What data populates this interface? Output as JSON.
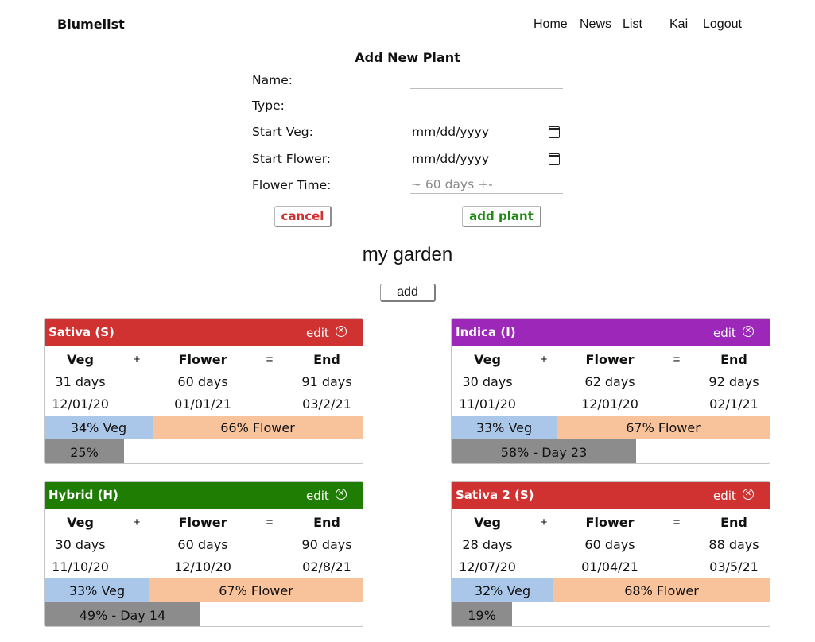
{
  "app": {
    "brand": "Blumelist",
    "nav": {
      "home": "Home",
      "news": "News",
      "list": "List",
      "user": "Kai",
      "logout": "Logout"
    }
  },
  "form": {
    "title": "Add New Plant",
    "fields": [
      {
        "label": "Name:",
        "value": "",
        "placeholder": ""
      },
      {
        "label": "Type:",
        "value": "",
        "placeholder": ""
      },
      {
        "label": "Start Veg:",
        "value": "mm/dd/yyyy",
        "placeholder": ""
      },
      {
        "label": "Start Flower:",
        "value": "mm/dd/yyyy",
        "placeholder": ""
      },
      {
        "label": "Flower Time:",
        "value": "",
        "placeholder": "~ 60 days +-"
      }
    ],
    "cancel_label": "cancel",
    "add_plant_label": "add plant"
  },
  "garden": {
    "title": "my garden",
    "add_label": "add"
  },
  "colors": {
    "sativa": "#d03131",
    "indica": "#9c27b8",
    "hybrid": "#1f7d04",
    "veg_bar": "#aac7ea",
    "flower_bar": "#f8c29b",
    "progress": "#8c8c8c"
  },
  "plants": [
    {
      "name": "Sativa (S)",
      "edit_label": "edit",
      "remove_icon": "close-circle-icon",
      "color": "#d03131",
      "headers": {
        "veg": "Veg",
        "plus": "+",
        "flower": "Flower",
        "equals": "=",
        "end": "End"
      },
      "veg_days": "31 days",
      "flower_days": "60 days",
      "end_days": "91 days",
      "veg_date": "12/01/20",
      "flower_date": "01/01/21",
      "end_date": "03/2/21",
      "veg_pct": 34,
      "veg_label": "34% Veg",
      "flower_label": "66% Flower",
      "progress_pct": 25,
      "progress_label": "25%"
    },
    {
      "name": "Indica (I)",
      "edit_label": "edit",
      "remove_icon": "close-circle-icon",
      "color": "#9c27b8",
      "headers": {
        "veg": "Veg",
        "plus": "+",
        "flower": "Flower",
        "equals": "=",
        "end": "End"
      },
      "veg_days": "30 days",
      "flower_days": "62 days",
      "end_days": "92 days",
      "veg_date": "11/01/20",
      "flower_date": "12/01/20",
      "end_date": "02/1/21",
      "veg_pct": 33,
      "veg_label": "33% Veg",
      "flower_label": "67% Flower",
      "progress_pct": 58,
      "progress_label": "58% - Day 23"
    },
    {
      "name": "Hybrid (H)",
      "edit_label": "edit",
      "remove_icon": "close-circle-icon",
      "color": "#1f7d04",
      "headers": {
        "veg": "Veg",
        "plus": "+",
        "flower": "Flower",
        "equals": "=",
        "end": "End"
      },
      "veg_days": "30 days",
      "flower_days": "60 days",
      "end_days": "90 days",
      "veg_date": "11/10/20",
      "flower_date": "12/10/20",
      "end_date": "02/8/21",
      "veg_pct": 33,
      "veg_label": "33% Veg",
      "flower_label": "67% Flower",
      "progress_pct": 49,
      "progress_label": "49% - Day 14"
    },
    {
      "name": "Sativa 2 (S)",
      "edit_label": "edit",
      "remove_icon": "close-circle-icon",
      "color": "#d03131",
      "headers": {
        "veg": "Veg",
        "plus": "+",
        "flower": "Flower",
        "equals": "=",
        "end": "End"
      },
      "veg_days": "28 days",
      "flower_days": "60 days",
      "end_days": "88 days",
      "veg_date": "12/07/20",
      "flower_date": "01/04/21",
      "end_date": "03/5/21",
      "veg_pct": 32,
      "veg_label": "32% Veg",
      "flower_label": "68% Flower",
      "progress_pct": 19,
      "progress_label": "19%"
    }
  ]
}
